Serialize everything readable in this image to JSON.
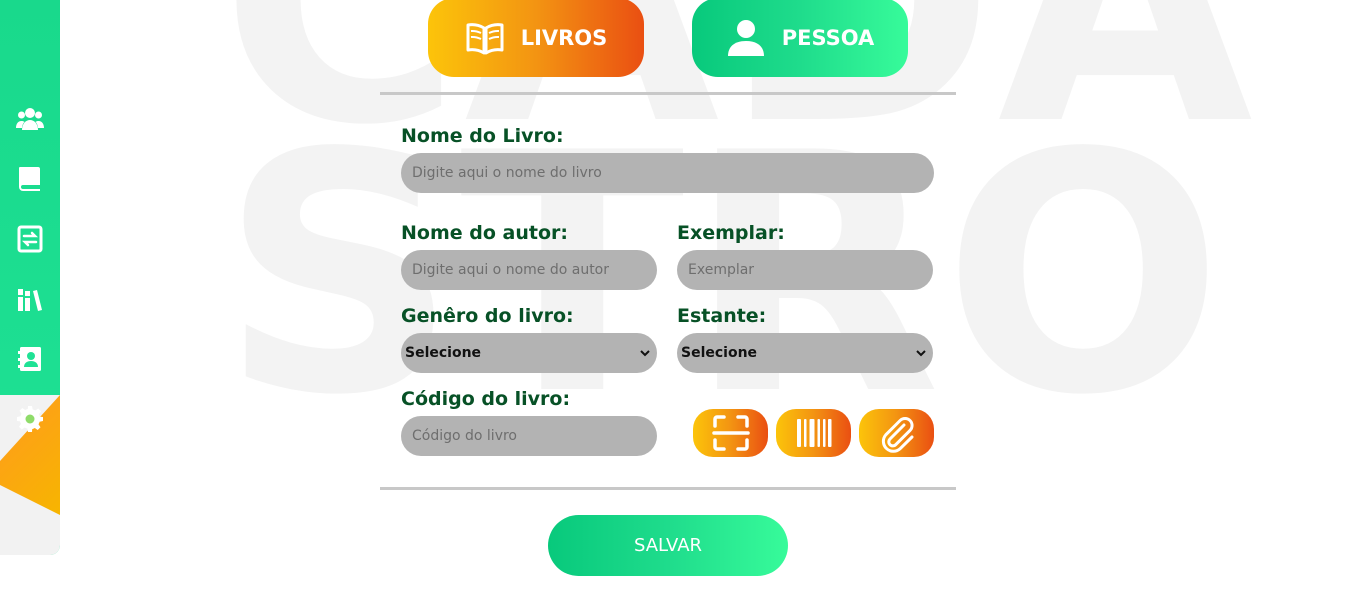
{
  "background": {
    "watermark_lines": [
      "CADA",
      "STRO"
    ],
    "watermark_color": "#f3f3f3"
  },
  "sidebar": {
    "color": "#1fe295",
    "accent_color": "#f7b500",
    "items": [
      {
        "icon": "users-icon"
      },
      {
        "icon": "book-icon"
      },
      {
        "icon": "loan-exchange-icon"
      },
      {
        "icon": "bookshelf-icon"
      },
      {
        "icon": "contact-card-icon"
      },
      {
        "icon": "gear-icon"
      }
    ]
  },
  "tabs": [
    {
      "label": "LIVROS",
      "icon": "open-book-icon",
      "color_from": "#fcc40a",
      "color_to": "#ea4f12"
    },
    {
      "label": "PESSOA",
      "icon": "person-icon",
      "color_from": "#08c97c",
      "color_to": "#37fb9a"
    }
  ],
  "form": {
    "book_name": {
      "label": "Nome do Livro:",
      "placeholder": "Digite aqui o nome do livro",
      "value": ""
    },
    "author": {
      "label": "Nome do autor:",
      "placeholder": "Digite aqui o nome do autor",
      "value": ""
    },
    "copy": {
      "label": "Exemplar:",
      "placeholder": "Exemplar",
      "value": ""
    },
    "genre": {
      "label": "Genêro do livro:",
      "selected": "Selecione"
    },
    "shelf": {
      "label": "Estante:",
      "selected": "Selecione"
    },
    "code": {
      "label": "Código do livro:",
      "placeholder": "Código do livro",
      "value": ""
    },
    "tools": [
      {
        "icon": "scan-icon"
      },
      {
        "icon": "barcode-icon"
      },
      {
        "icon": "paperclip-icon"
      }
    ]
  },
  "save_label": "SALVAR",
  "colors": {
    "label_text": "#075126",
    "field_bg": "#b3b3b3",
    "divider": "#c8c8c8"
  }
}
